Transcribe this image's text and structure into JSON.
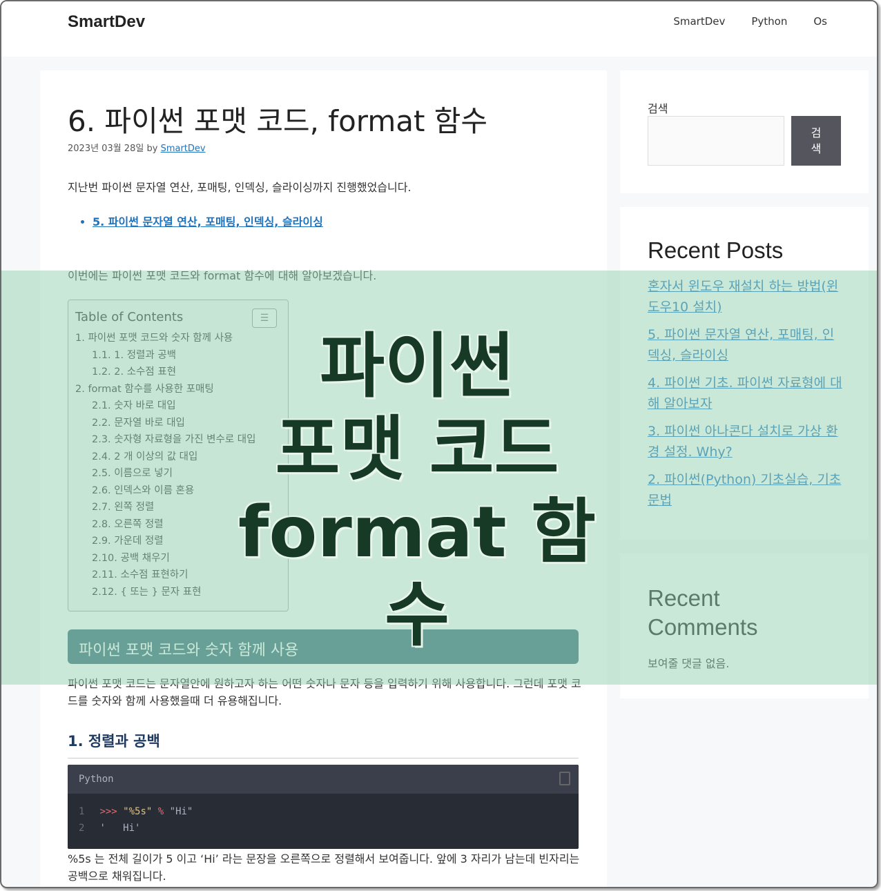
{
  "header": {
    "brand": "SmartDev",
    "nav": [
      "SmartDev",
      "Python",
      "Os"
    ]
  },
  "post": {
    "title": "6. 파이썬 포맷 코드, format 함수",
    "date": "2023년 03월 28일",
    "by": "by",
    "author": "SmartDev",
    "intro": "지난번 파이썬 문자열 연산, 포매팅, 인덱싱, 슬라이싱까지 진행했었습니다.",
    "prev_link": "5. 파이썬 문자열 연산, 포매팅, 인덱싱, 슬라이싱",
    "lead": "이번에는 파이썬 포맷 코드와 format 함수에 대해 알아보겠습니다."
  },
  "toc": {
    "title": "Table of Contents",
    "toggle": "☰",
    "items": [
      {
        "label": "1. 파이썬 포맷 코드와 숫자 함께 사용",
        "sub": false
      },
      {
        "label": "1.1. 1. 정렬과 공백",
        "sub": true
      },
      {
        "label": "1.2. 2. 소수점 표현",
        "sub": true
      },
      {
        "label": "2. format 함수를 사용한 포매팅",
        "sub": false
      },
      {
        "label": "2.1. 숫자 바로 대입",
        "sub": true
      },
      {
        "label": "2.2. 문자열 바로 대입",
        "sub": true
      },
      {
        "label": "2.3. 숫자형 자료형을 가진 변수로 대입",
        "sub": true
      },
      {
        "label": "2.4. 2 개 이상의 값 대입",
        "sub": true
      },
      {
        "label": "2.5. 이름으로 넣기",
        "sub": true
      },
      {
        "label": "2.6. 인덱스와 이름 혼용",
        "sub": true
      },
      {
        "label": "2.7. 왼쪽 정렬",
        "sub": true
      },
      {
        "label": "2.8. 오른쪽 정렬",
        "sub": true
      },
      {
        "label": "2.9. 가운데 정렬",
        "sub": true
      },
      {
        "label": "2.10. 공백 채우기",
        "sub": true
      },
      {
        "label": "2.11. 소수점 표현하기",
        "sub": true
      },
      {
        "label": "2.12. { 또는 } 문자 표현",
        "sub": true
      }
    ]
  },
  "section": {
    "h2": "파이썬 포맷 코드와 숫자 함께 사용",
    "p": "파이썬 포맷 코드는 문자열안에 원하고자 하는 어떤 숫자나 문자 등을 입력하기 위해 사용합니다. 그런데 포맷 코드를 숫자와 함께 사용했을때 더 유용해집니다.",
    "h3": "1. 정렬과 공백",
    "code_lang": "Python",
    "code_lines": [
      {
        "n": "1",
        "prompt": ">>>",
        "s1": "\"%5s\"",
        "op": "%",
        "s2": "\"Hi\""
      },
      {
        "n": "2",
        "text": "'   Hi'"
      }
    ],
    "explain": "%5s 는 전체 길이가 5 이고 ‘Hi’ 라는 문장을 오른쪽으로 정렬해서 보여줍니다. 앞에 3 자리가 남는데 빈자리는 공백으로 채워집니다."
  },
  "sidebar": {
    "search_label": "검색",
    "search_button": "검색",
    "recent_posts_title": "Recent Posts",
    "recent_posts": [
      "혼자서 윈도우 재설치 하는 방법(윈도우10 설치)",
      "5. 파이썬 문자열 연산, 포매팅, 인덱싱, 슬라이싱",
      "4. 파이썬 기초. 파이썬 자료형에 대해 알아보자",
      "3. 파이썬 아나콘다 설치로 가상 환경 설정. Why?",
      "2. 파이썬(Python) 기초실습, 기초문법"
    ],
    "recent_comments_title": "Recent Comments",
    "no_comments": "보여줄 댓글 없음."
  },
  "overlay": {
    "line1": "파이썬",
    "line2": "포맷 코드",
    "line3": "format 함수"
  },
  "colors": {
    "link": "#1e73be",
    "h2_bar": "#3a6f7e",
    "overlay": "#96d2af"
  }
}
